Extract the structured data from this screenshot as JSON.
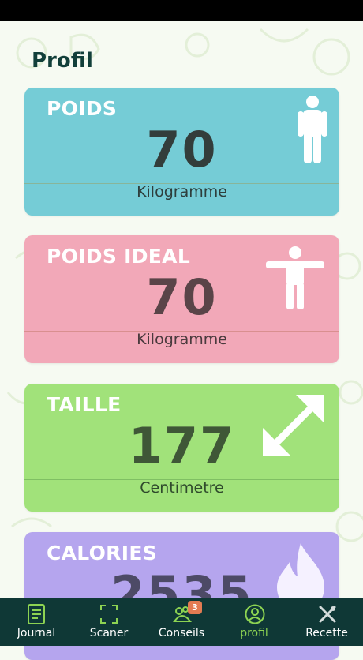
{
  "page": {
    "title": "Profil"
  },
  "colors": {
    "poids_card": "#75ccd6",
    "poids_ideal_card": "#f2a8b8",
    "taille_card": "#a1e27a",
    "calories_card": "#b5a5ee",
    "nav_background": "#0f3836",
    "nav_active": "#8dd352"
  },
  "cards": [
    {
      "label": "POIDS",
      "value": "70",
      "unit": "Kilogramme",
      "icon": "person-standing-icon"
    },
    {
      "label": "POIDS IDEAL",
      "value": "70",
      "unit": "Kilogramme",
      "icon": "person-arms-out-icon"
    },
    {
      "label": "TAILLE",
      "value": "177",
      "unit": "Centimetre",
      "icon": "diagonal-arrows-icon"
    },
    {
      "label": "CALORIES",
      "value": "2535",
      "unit": "",
      "icon": "flame-icon"
    }
  ],
  "nav": {
    "items": [
      {
        "label": "Journal",
        "icon": "journal-icon"
      },
      {
        "label": "Scaner",
        "icon": "scan-icon"
      },
      {
        "label": "Conseils",
        "icon": "conseils-icon",
        "badge": "3"
      },
      {
        "label": "profil",
        "icon": "profile-icon",
        "active": true
      },
      {
        "label": "Recette",
        "icon": "fork-knife-icon"
      }
    ]
  }
}
